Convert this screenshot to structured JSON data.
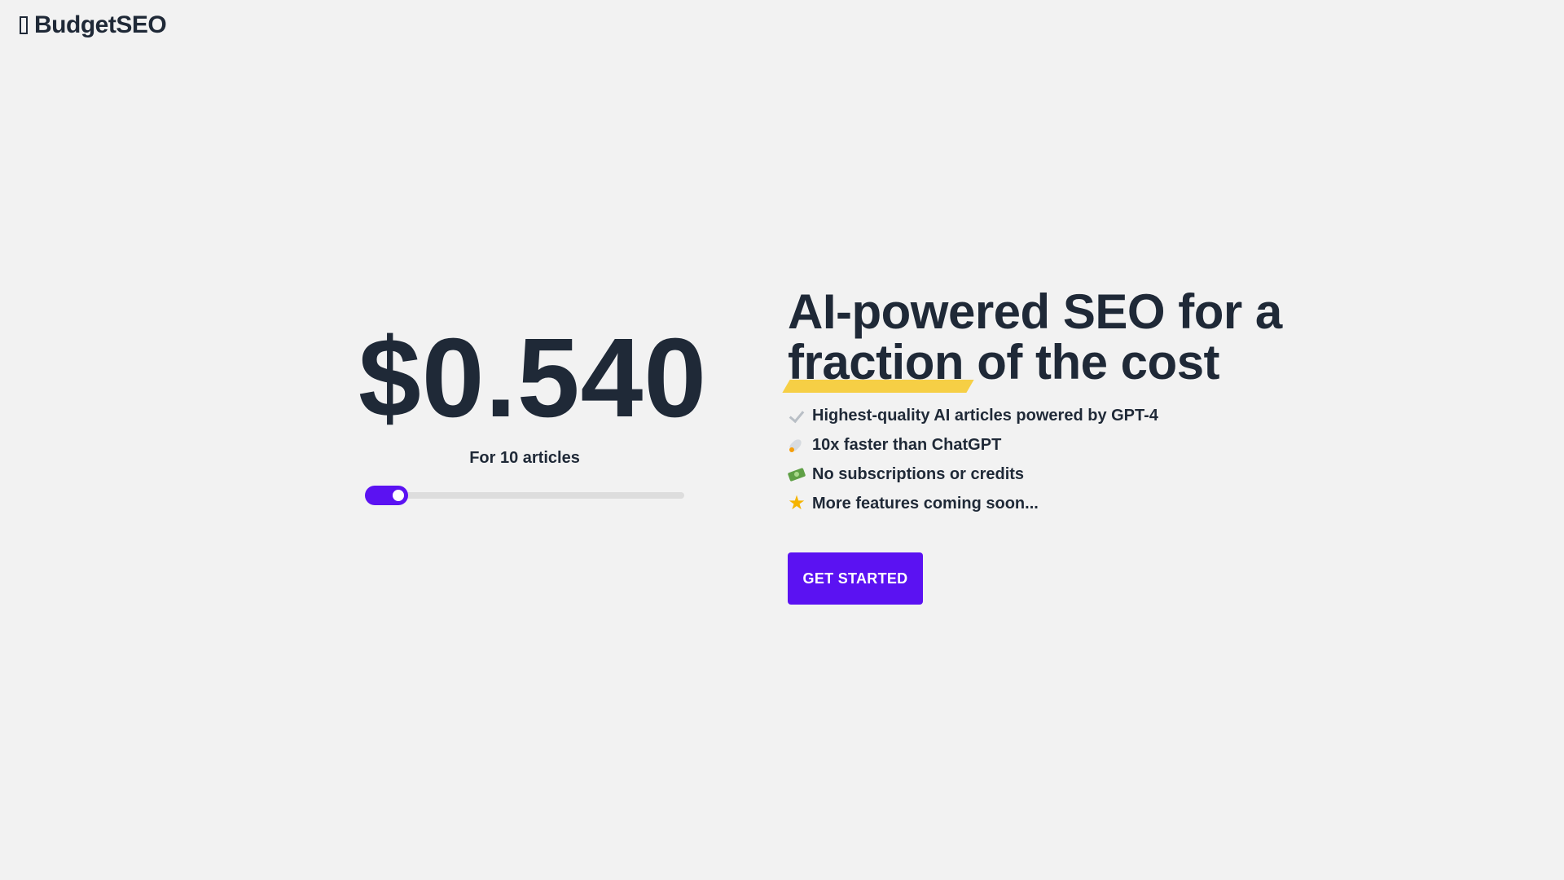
{
  "brand": {
    "name": "BudgetSEO",
    "logo_icon": "hourglass-icon"
  },
  "pricing": {
    "price": "$0.540",
    "article_note": "For 10 articles",
    "slider": {
      "value_fraction": 0.08,
      "accent_color": "#5b12f2",
      "track_color": "#dddddd"
    }
  },
  "hero": {
    "headline_part1": "AI-powered SEO for a",
    "headline_highlight": "fraction",
    "headline_part2": " of the cost",
    "highlight_color": "#f6cf45",
    "features": [
      {
        "icon": "check-icon",
        "text": "Highest-quality AI articles powered by GPT-4"
      },
      {
        "icon": "rocket-icon",
        "text": "10x faster than ChatGPT"
      },
      {
        "icon": "money-icon",
        "text": "No subscriptions or credits"
      },
      {
        "icon": "star-icon",
        "text": "More features coming soon..."
      }
    ],
    "cta_label": "GET STARTED",
    "cta_color": "#5b12f2"
  },
  "page": {
    "background": "#f2f2f2",
    "text_color": "#1f2937"
  }
}
